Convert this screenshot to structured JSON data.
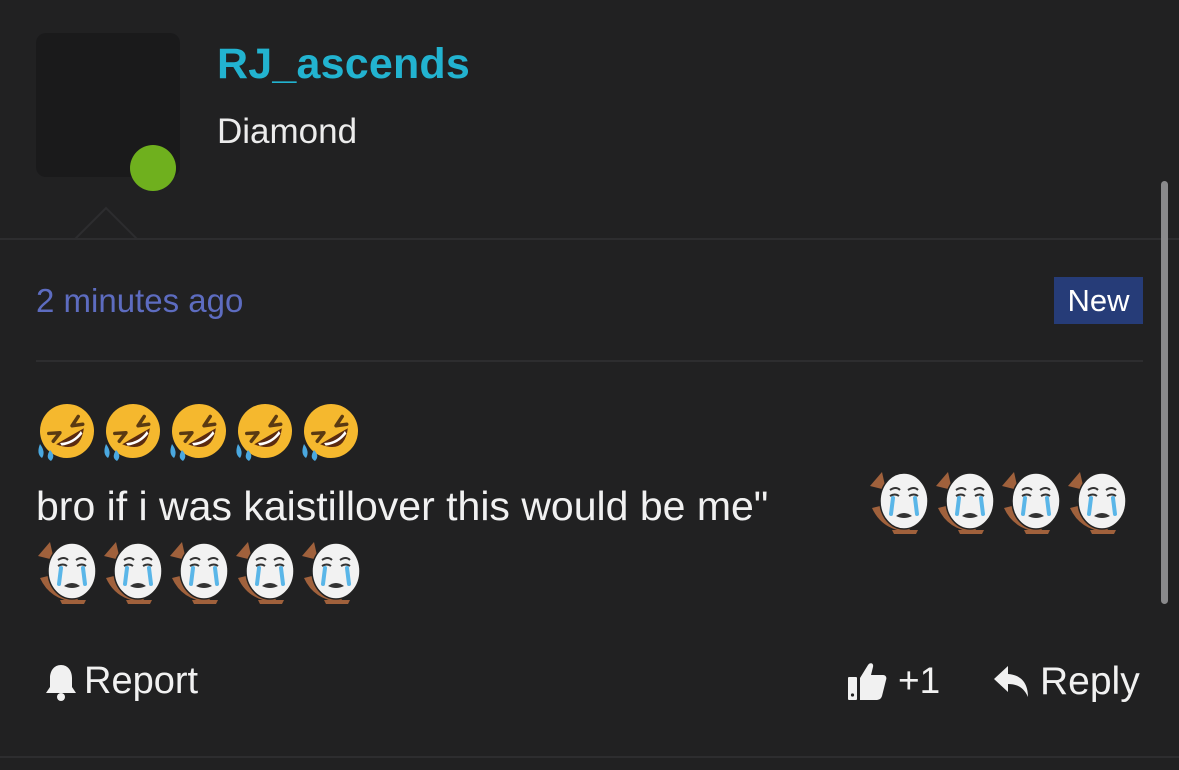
{
  "post": {
    "author": {
      "username": "RJ_ascends",
      "rank": "Diamond",
      "status": "online"
    },
    "timestamp": "2 minutes ago",
    "badge": "New",
    "emoji_line": [
      "rofl-emoji",
      "rofl-emoji",
      "rofl-emoji",
      "rofl-emoji",
      "rofl-emoji"
    ],
    "text": "bro if i was kaistillover this would be me\"",
    "trailing_emojis": [
      "crying-wojak-emoji",
      "crying-wojak-emoji",
      "crying-wojak-emoji",
      "crying-wojak-emoji",
      "crying-wojak-emoji",
      "crying-wojak-emoji",
      "crying-wojak-emoji",
      "crying-wojak-emoji",
      "crying-wojak-emoji"
    ]
  },
  "actions": {
    "report_label": "Report",
    "like_label": "+1",
    "reply_label": "Reply"
  },
  "colors": {
    "background": "#212122",
    "username": "#22b3d0",
    "timestamp": "#5d6cc0",
    "badge_bg": "#263c78",
    "online": "#6fb01e"
  }
}
